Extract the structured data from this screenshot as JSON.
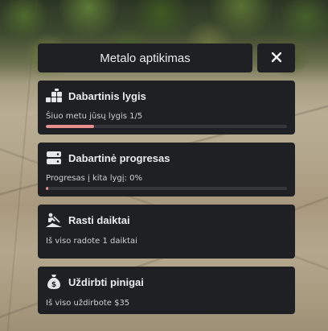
{
  "window": {
    "title": "Metalo aptikimas",
    "close_icon": "close-icon"
  },
  "cards": [
    {
      "icon": "stairs-level-icon",
      "title": "Dabartinis lygis",
      "subtitle": "Šiuo metu jūsų lygis 1/5",
      "progress_percent": 20,
      "bar_color": "#e88f8f"
    },
    {
      "icon": "server-progress-icon",
      "title": "Dabartinė progresas",
      "subtitle": "Progresas į kita lygį: 0%",
      "progress_percent": 0,
      "bar_color": "#e88f8f"
    },
    {
      "icon": "digging-icon",
      "title": "Rasti daiktai",
      "subtitle": "Iš viso radote 1 daiktai"
    },
    {
      "icon": "money-bag-icon",
      "title": "Uždirbti pinigai",
      "subtitle": "Iš viso uždirbote $35"
    }
  ],
  "colors": {
    "panel_bg": "#1f2024",
    "bar_track": "#35363b",
    "bar_fill": "#e88f8f",
    "text": "#ececee"
  }
}
